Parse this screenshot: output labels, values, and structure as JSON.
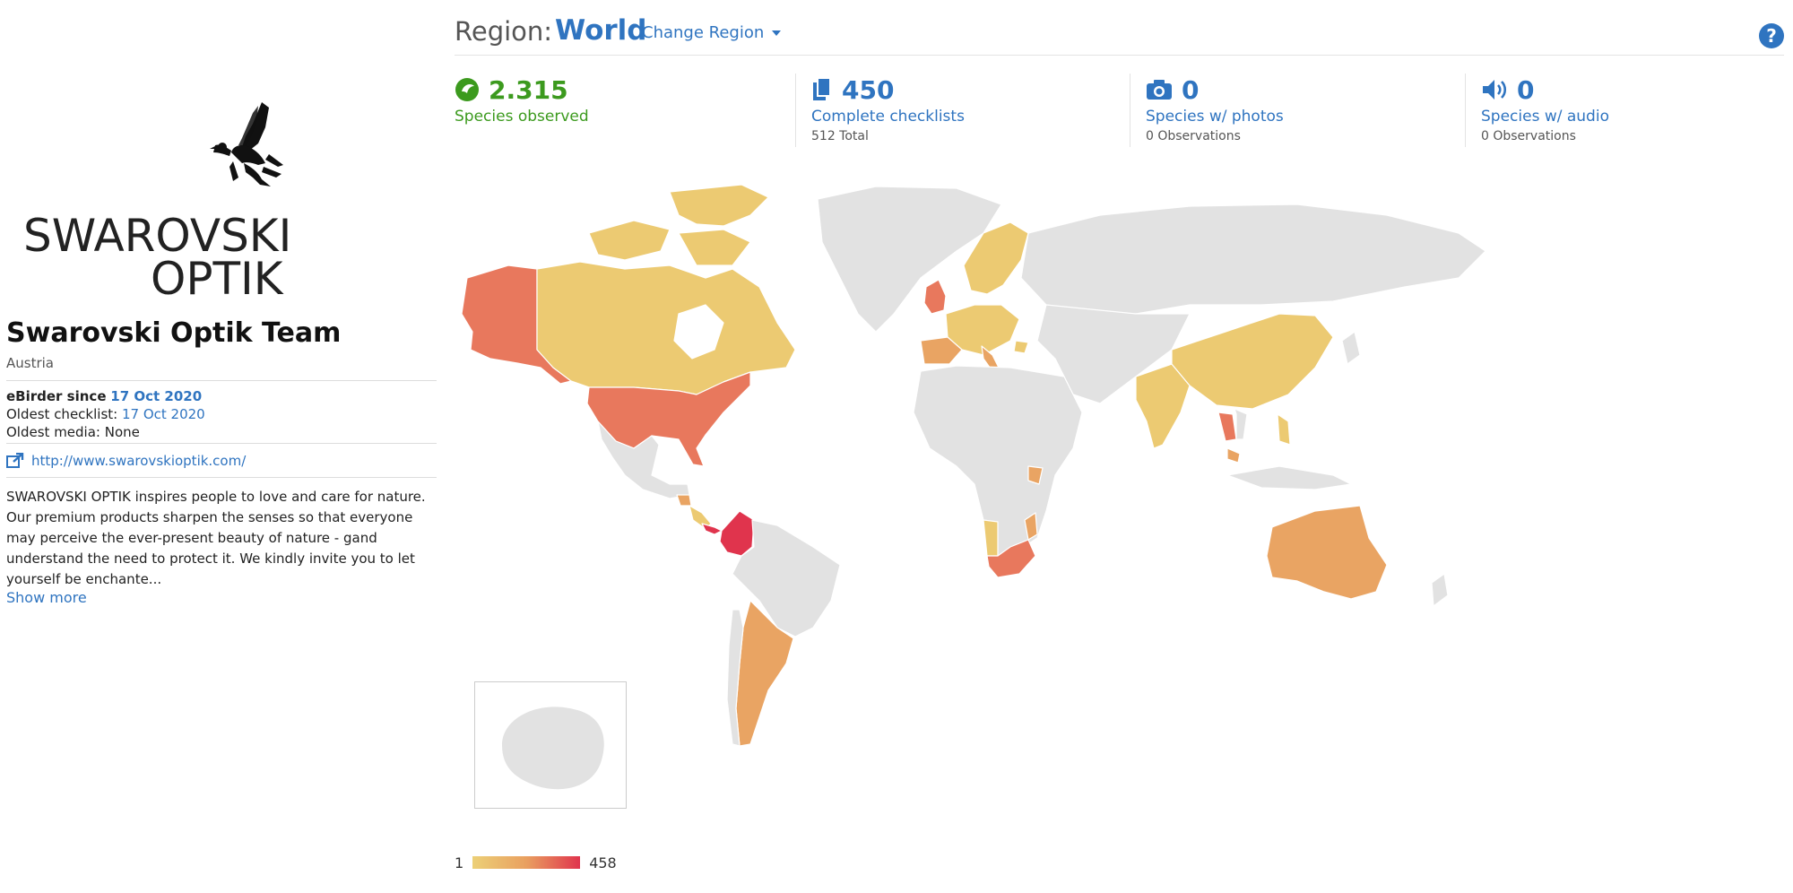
{
  "profile": {
    "logo_line1": "SWAROVSKI",
    "logo_line2": "OPTIK",
    "name": "Swarovski Optik Team",
    "country": "Austria",
    "ebirder_since_label": "eBirder since",
    "ebirder_since_value": "17 Oct 2020",
    "oldest_checklist_label": "Oldest checklist:",
    "oldest_checklist_value": "17 Oct 2020",
    "oldest_media_label": "Oldest media:",
    "oldest_media_value": "None",
    "website": "http://www.swarovskioptik.com/",
    "bio": "SWAROVSKI OPTIK inspires people to love and care for nature. Our premium products sharpen the senses so that everyone may perceive the ever-present beauty of nature - gand understand the need to protect it. We kindly invite you to let yourself be enchante...",
    "show_more": "Show more"
  },
  "region": {
    "label": "Region:",
    "value": "World",
    "change_label": "Change Region"
  },
  "help_label": "?",
  "stats": [
    {
      "value": "2.315",
      "label": "Species observed",
      "sub": "",
      "icon": "species-icon",
      "color": "#3c9a1e"
    },
    {
      "value": "450",
      "label": "Complete checklists",
      "sub": "512 Total",
      "icon": "checklist-icon",
      "color": "#2f74c0"
    },
    {
      "value": "0",
      "label": "Species w/ photos",
      "sub": "0 Observations",
      "icon": "camera-icon",
      "color": "#2f74c0"
    },
    {
      "value": "0",
      "label": "Species w/ audio",
      "sub": "0 Observations",
      "icon": "audio-icon",
      "color": "#2f74c0"
    }
  ],
  "legend": {
    "min": "1",
    "max": "458",
    "color_low": "#ecd077",
    "color_mid": "#e9a060",
    "color_high": "#e0344d"
  },
  "map_colors": {
    "no_data": "#e2e2e2",
    "low": "#ecca72",
    "mid": "#e9a463",
    "midhigh": "#e8785d",
    "high": "#e0344d"
  }
}
